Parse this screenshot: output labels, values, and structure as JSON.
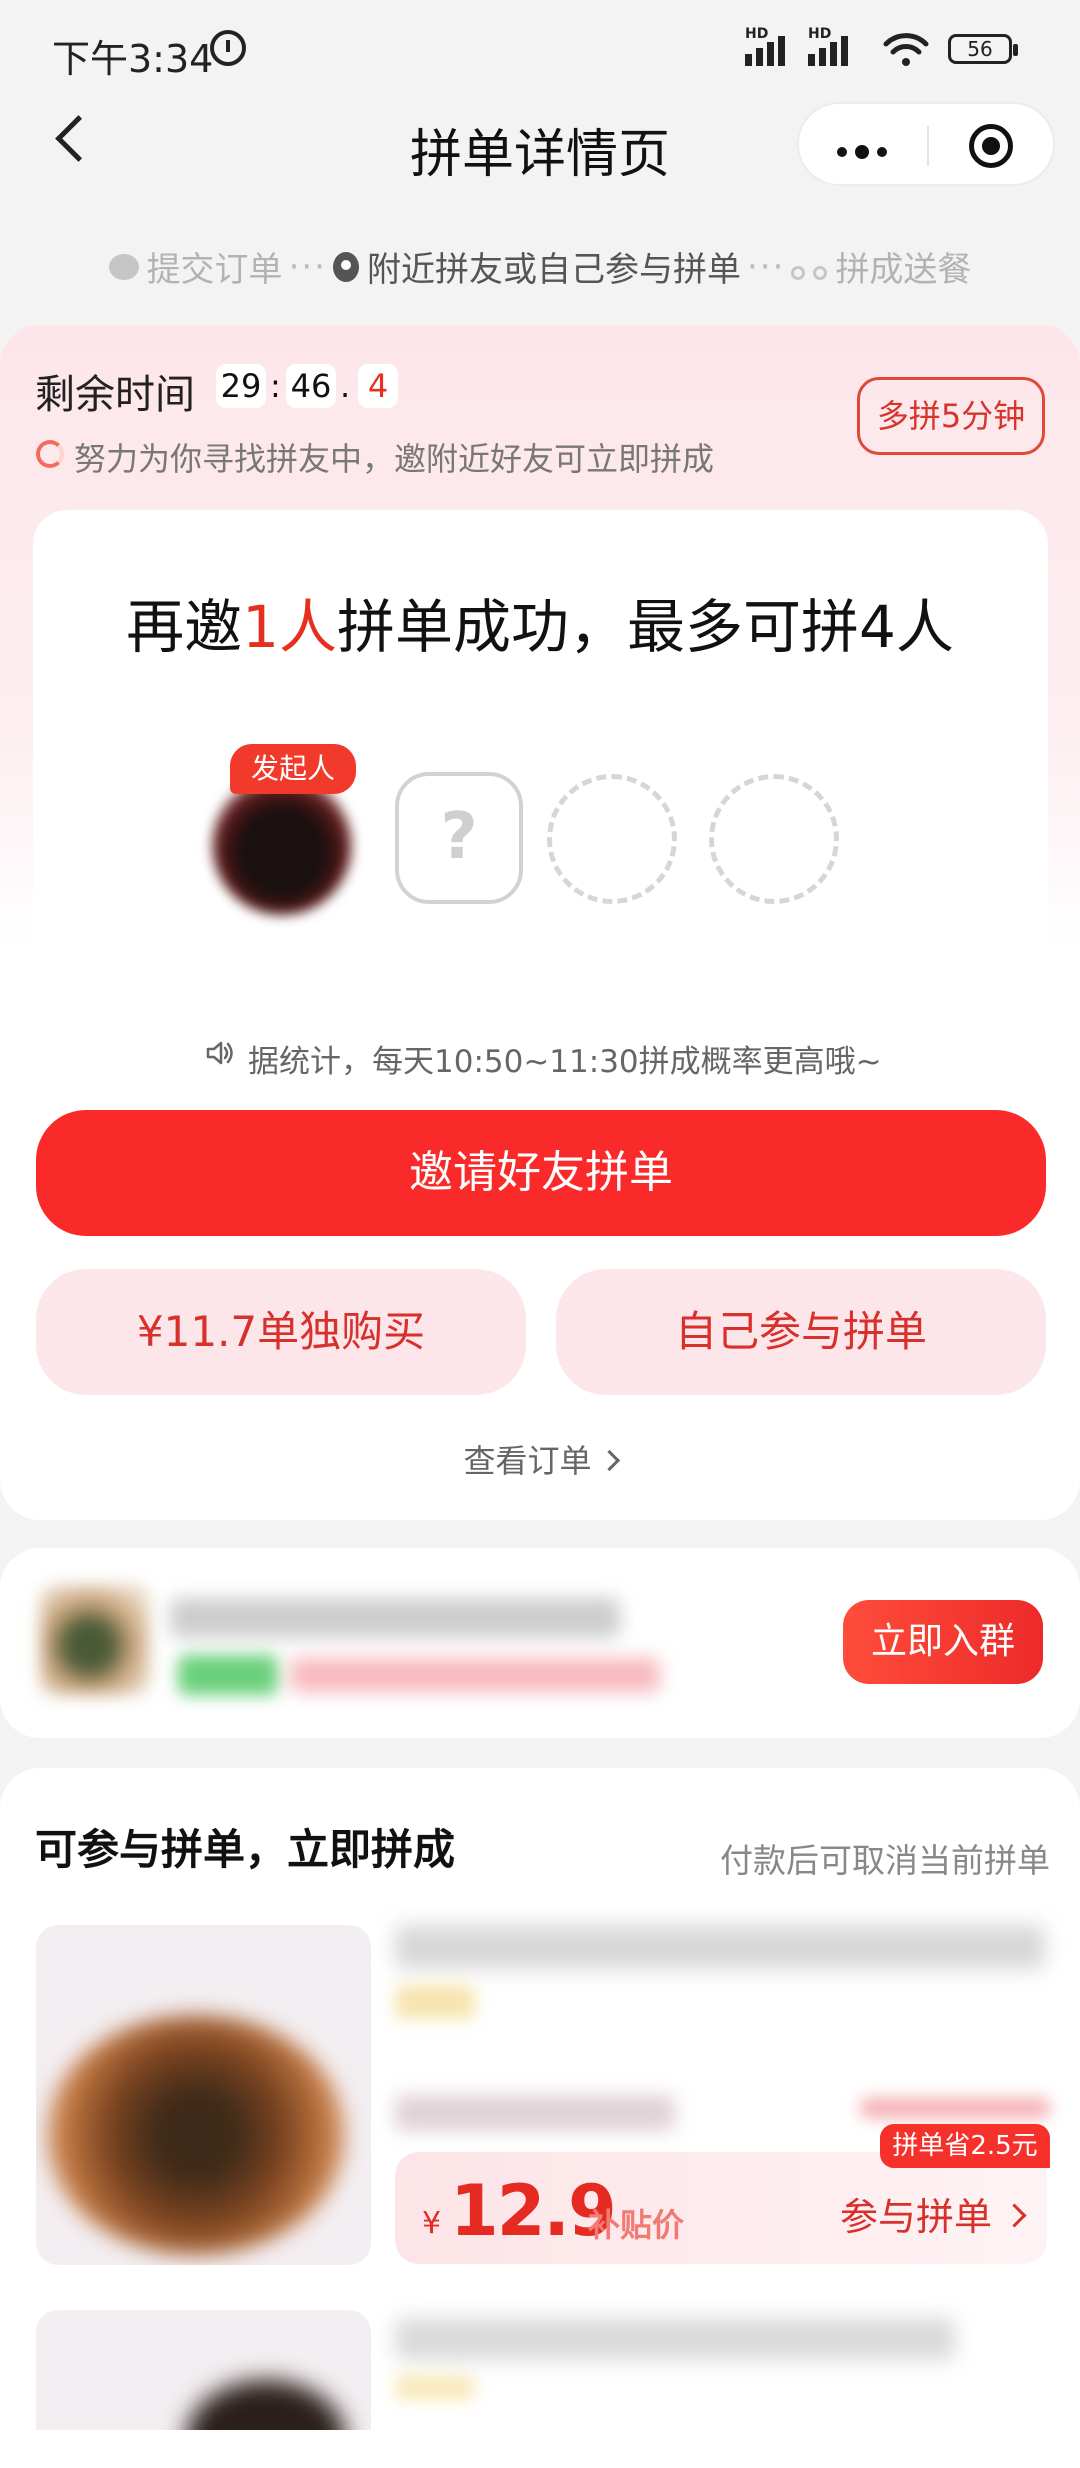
{
  "status_bar": {
    "time": "下午3:34",
    "signal_label_1": "HD",
    "signal_label_2": "HD",
    "battery": "56"
  },
  "nav": {
    "title": "拼单详情页"
  },
  "steps": [
    {
      "label": "提交订单",
      "icon": "chat-icon",
      "active": false
    },
    {
      "label": "附近拼友或自己参与拼单",
      "icon": "location-pin-icon",
      "active": true
    },
    {
      "label": "拼成送餐",
      "icon": "scooter-icon",
      "active": false
    }
  ],
  "step_separator": "···",
  "countdown": {
    "label": "剩余时间",
    "minutes": "29",
    "seconds": "46",
    "tenths": "4",
    "sep_colon": ":",
    "sep_dot": ".",
    "searching_text": "努力为你寻找拼友中，邀附近好友可立即拼成",
    "extend_button": "多拼5分钟"
  },
  "headline": {
    "prefix": "再邀",
    "count": "1人",
    "suffix": "拼单成功，最多可拼4人"
  },
  "participants": {
    "host_badge": "发起人",
    "unknown_slot": "?"
  },
  "tip": {
    "text": "据统计，每天10:50~11:30拼成概率更高哦~"
  },
  "actions": {
    "invite": "邀请好友拼单",
    "buy_alone": "¥11.7单独购买",
    "join_self": "自己参与拼单",
    "view_order": "查看订单"
  },
  "group_banner": {
    "join_button": "立即入群"
  },
  "list_section": {
    "title": "可参与拼单，立即拼成",
    "note": "付款后可取消当前拼单",
    "items": [
      {
        "save_badge": "拼单省2.5元",
        "currency": "¥",
        "price": "12.9",
        "price_tag": "补贴价",
        "join_label": "参与拼单"
      }
    ]
  },
  "colors": {
    "accent_red": "#fb2a2a",
    "soft_pink": "#fde6ea",
    "text_red": "#d8302a"
  }
}
